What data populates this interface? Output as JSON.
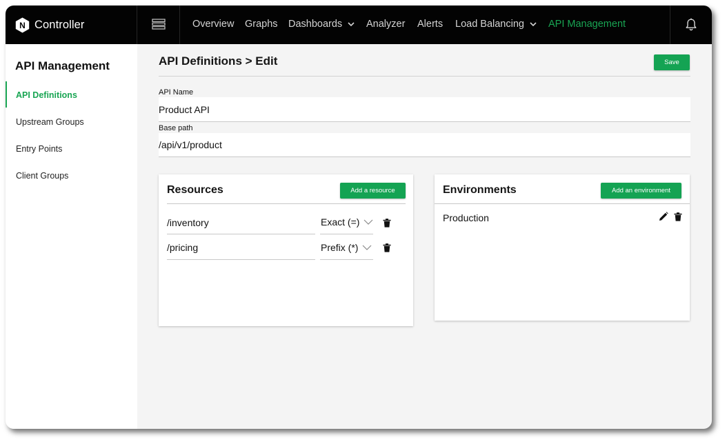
{
  "brand": {
    "name": "Controller",
    "logo_letter": "N"
  },
  "nav": {
    "items": [
      {
        "label": "Overview"
      },
      {
        "label": "Graphs"
      },
      {
        "label": "Dashboards"
      },
      {
        "label": "Analyzer"
      },
      {
        "label": "Alerts"
      },
      {
        "label": "Load Balancing"
      },
      {
        "label": "API Management"
      }
    ],
    "active_item": "API Management",
    "dropdown_items": [
      "Dashboards",
      "Load Balancing"
    ]
  },
  "icons": {
    "menu": "list-menu-icon",
    "notifications": "bell-icon",
    "edit": "pencil-icon",
    "delete": "trash-icon",
    "dropdown": "chevron-down-icon"
  },
  "colors": {
    "accent": "#19a553",
    "topbar": "#030303",
    "page_bg": "#f4f4f4"
  },
  "sidebar": {
    "title": "API Management",
    "items": [
      {
        "label": "API Definitions"
      },
      {
        "label": "Upstream Groups"
      },
      {
        "label": "Entry Points"
      },
      {
        "label": "Client Groups"
      }
    ],
    "active_item": "API Definitions"
  },
  "main": {
    "title": "API Definitions > Edit",
    "save_label": "Save",
    "api_name": {
      "label": "API Name",
      "value": "Product API"
    },
    "base_path": {
      "label": "Base path",
      "value": "/api/v1/product"
    }
  },
  "resources": {
    "title": "Resources",
    "add_label": "Add a resource",
    "rows": [
      {
        "path": "/inventory",
        "match": "Exact (=)"
      },
      {
        "path": "/pricing",
        "match": "Prefix (*)"
      }
    ]
  },
  "environments": {
    "title": "Environments",
    "add_label": "Add an environment",
    "items": [
      {
        "name": "Production"
      }
    ]
  }
}
